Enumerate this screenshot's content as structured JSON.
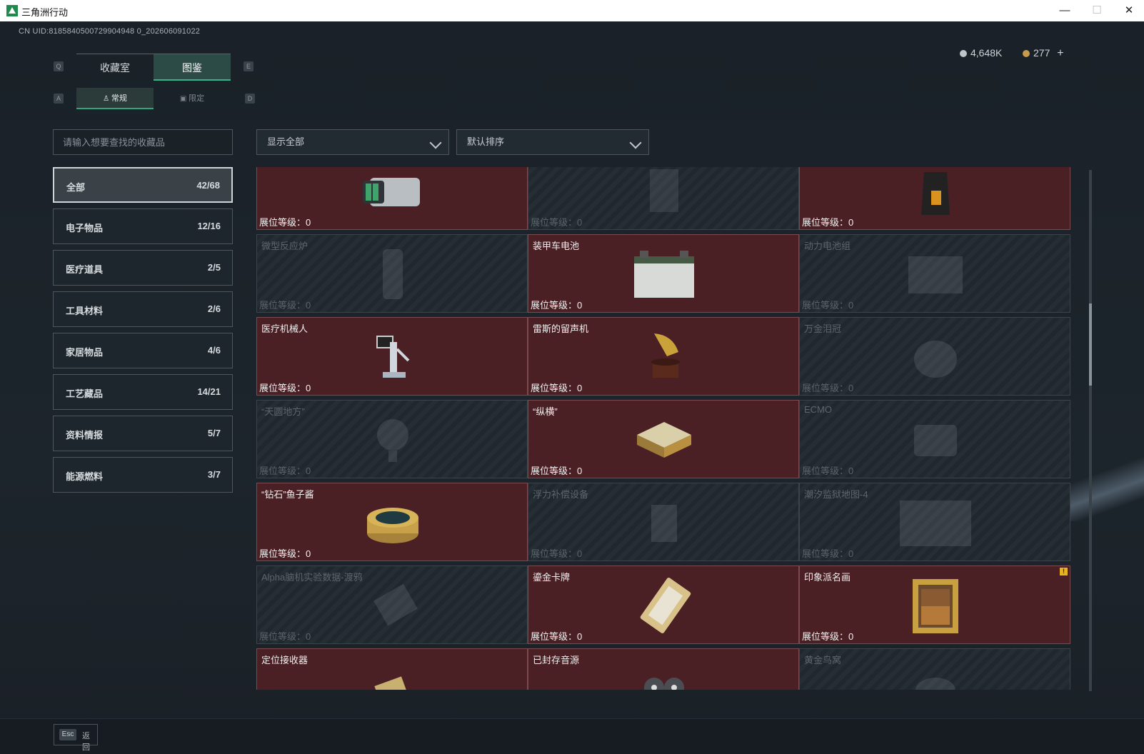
{
  "window": {
    "title": "三角洲行动",
    "minimize": "—",
    "maximize": "☐",
    "close": "✕"
  },
  "header": {
    "uid": "CN UID:8185840500729904948 0_202606091022",
    "currency1": {
      "value": "4,648K",
      "color": "#bfc5c9"
    },
    "currency2": {
      "value": "277",
      "add": "+",
      "color": "#c79a4f"
    }
  },
  "keys": {
    "q": "Q",
    "e": "E",
    "a": "A",
    "d": "D"
  },
  "tabs": [
    {
      "label": "收藏室"
    },
    {
      "label": "图鉴"
    }
  ],
  "subtabs": [
    {
      "label": "常规"
    },
    {
      "label": "限定"
    }
  ],
  "search": {
    "placeholder": "请输入想要查找的收藏品"
  },
  "filters": {
    "show": "显示全部",
    "sort": "默认排序"
  },
  "categories": [
    {
      "label": "全部",
      "count": "42/68"
    },
    {
      "label": "电子物品",
      "count": "12/16"
    },
    {
      "label": "医疗道具",
      "count": "2/5"
    },
    {
      "label": "工具材料",
      "count": "2/6"
    },
    {
      "label": "家居物品",
      "count": "4/6"
    },
    {
      "label": "工艺藏品",
      "count": "14/21"
    },
    {
      "label": "资料情报",
      "count": "5/7"
    },
    {
      "label": "能源燃料",
      "count": "3/7"
    }
  ],
  "items": [
    {
      "name": "",
      "level": "展位等级：0",
      "owned": true,
      "icon": "camera-icon"
    },
    {
      "name": "",
      "level": "展位等级：0",
      "owned": false,
      "icon": "device-icon"
    },
    {
      "name": "",
      "level": "展位等级：0",
      "owned": true,
      "icon": "coffee-bag-icon"
    },
    {
      "name": "微型反应炉",
      "level": "展位等级：0",
      "owned": false,
      "icon": "reactor-icon"
    },
    {
      "name": "装甲车电池",
      "level": "展位等级：0",
      "owned": true,
      "icon": "battery-icon"
    },
    {
      "name": "动力电池组",
      "level": "展位等级：0",
      "owned": false,
      "icon": "battery-pack-icon"
    },
    {
      "name": "医疗机械人",
      "level": "展位等级：0",
      "owned": true,
      "icon": "medical-robot-icon"
    },
    {
      "name": "雷斯的留声机",
      "level": "展位等级：0",
      "owned": true,
      "icon": "gramophone-icon"
    },
    {
      "name": "万金泪冠",
      "level": "展位等级：0",
      "owned": false,
      "icon": "crown-icon"
    },
    {
      "name": "“天圆地方”",
      "level": "展位等级：0",
      "owned": false,
      "icon": "globe-icon"
    },
    {
      "name": "“纵横”",
      "level": "展位等级：0",
      "owned": true,
      "icon": "chess-box-icon"
    },
    {
      "name": "ECMO",
      "level": "展位等级：0",
      "owned": false,
      "icon": "ecmo-icon"
    },
    {
      "name": "“钻石”鱼子酱",
      "level": "展位等级：0",
      "owned": true,
      "icon": "caviar-icon"
    },
    {
      "name": "浮力补偿设备",
      "level": "展位等级：0",
      "owned": false,
      "icon": "bcd-icon"
    },
    {
      "name": "潮汐监狱地图-4",
      "level": "展位等级：0",
      "owned": false,
      "icon": "map-icon"
    },
    {
      "name": "Alpha脑机实验数据-渡鸦",
      "level": "展位等级：0",
      "owned": false,
      "icon": "data-drive-icon"
    },
    {
      "name": "鎏金卡牌",
      "level": "展位等级：0",
      "owned": true,
      "icon": "gold-card-icon"
    },
    {
      "name": "印象派名画",
      "level": "展位等级：0",
      "owned": true,
      "icon": "painting-icon",
      "badge": "!"
    },
    {
      "name": "定位接收器",
      "level": "",
      "owned": true,
      "icon": "receiver-icon"
    },
    {
      "name": "已封存音源",
      "level": "",
      "owned": true,
      "icon": "tape-reel-icon"
    },
    {
      "name": "黄金鸟窝",
      "level": "",
      "owned": false,
      "icon": "nest-icon"
    }
  ],
  "footer": {
    "esc_key": "Esc",
    "back": "返回"
  }
}
